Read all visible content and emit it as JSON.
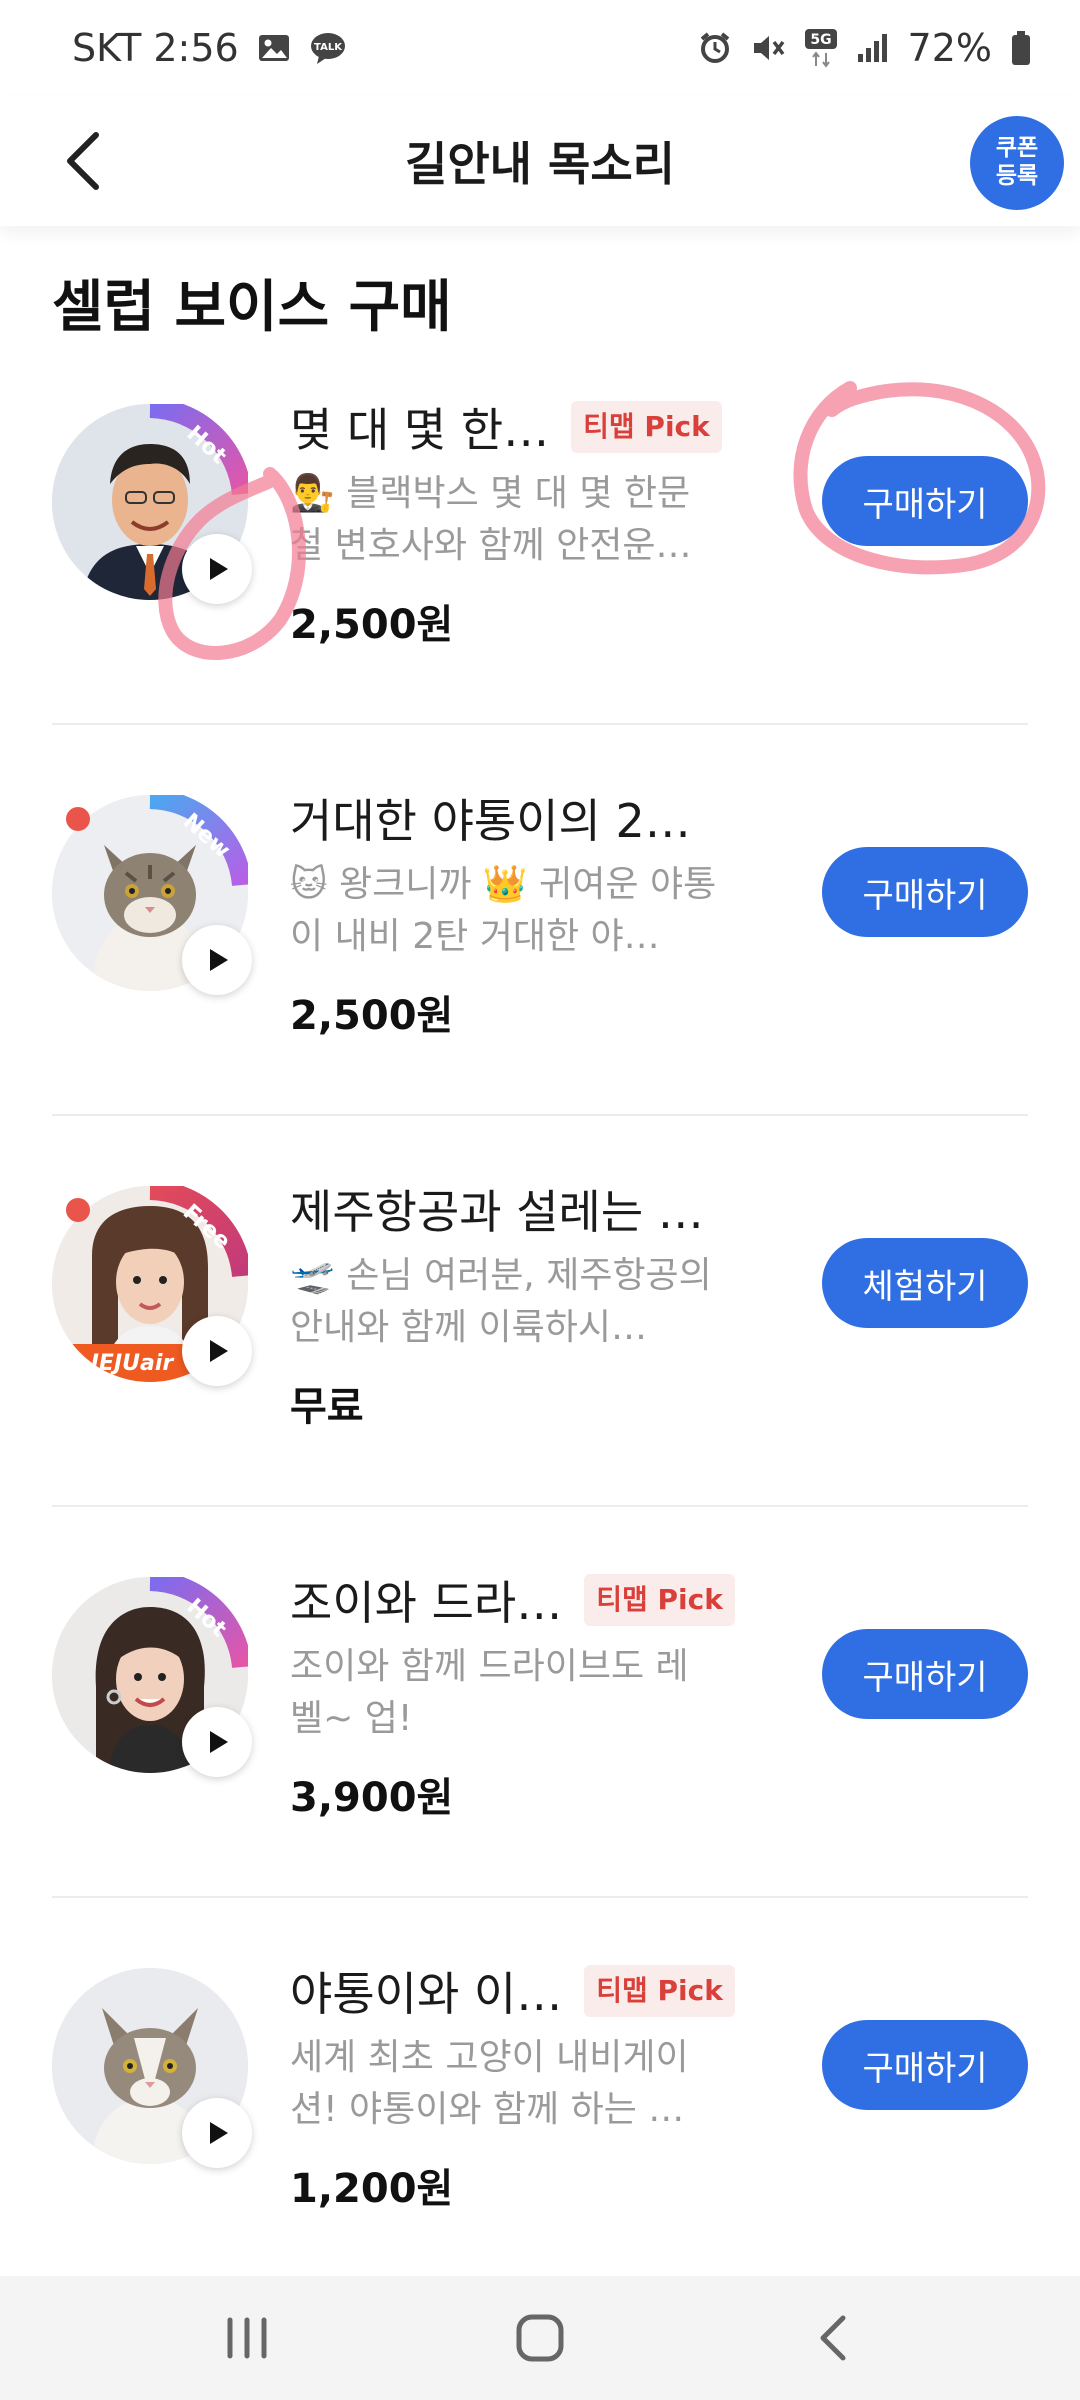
{
  "status_bar": {
    "carrier_time": "SKT 2:56",
    "battery": "72%",
    "network": "5G",
    "icons": [
      "image-icon",
      "talk-icon",
      "alarm-icon",
      "mute-icon",
      "5g-icon",
      "signal-icon",
      "battery-icon"
    ]
  },
  "header": {
    "title": "길안내 목소리",
    "coupon_line1": "쿠폰",
    "coupon_line2": "등록"
  },
  "section_title": "셀럽 보이스 구매",
  "badge_colors": {
    "hot": "#7b6cf0",
    "new": "#5a8ef0",
    "free": "#e24b5a"
  },
  "accent_color": "#2f6fe3",
  "items": [
    {
      "title": "몆 대 몇 한…",
      "pick": "티맵 Pick",
      "ring": "Hot",
      "desc": "👨‍⚖️ 블랙박스 몇 대 몇 한문철 변호사와 함께 안전운…",
      "price": "2,500원",
      "button": "구매하기"
    },
    {
      "title": "거대한 야통이의 2…",
      "pick": "",
      "ring": "New",
      "desc": "🐱 왕크니까 👑 귀여운 야통이 내비 2탄 거대한 야…",
      "price": "2,500원",
      "button": "구매하기"
    },
    {
      "title": "제주항공과 설레는 …",
      "pick": "",
      "ring": "Free",
      "desc": "🛫 손님 여러분, 제주항공의 안내와 함께 이륙하시…",
      "price": "무료",
      "button": "체험하기",
      "logo_text": "JEJUair"
    },
    {
      "title": "조이와 드라…",
      "pick": "티맵 Pick",
      "ring": "Hot",
      "desc": "조이와 함께 드라이브도 레벨~ 업!",
      "price": "3,900원",
      "button": "구매하기"
    },
    {
      "title": "야통이와 이…",
      "pick": "티맵 Pick",
      "ring": "",
      "desc": "세계 최초 고양이 내비게이션! 야통이와 함께 하는 …",
      "price": "1,200원",
      "button": "구매하기"
    }
  ]
}
